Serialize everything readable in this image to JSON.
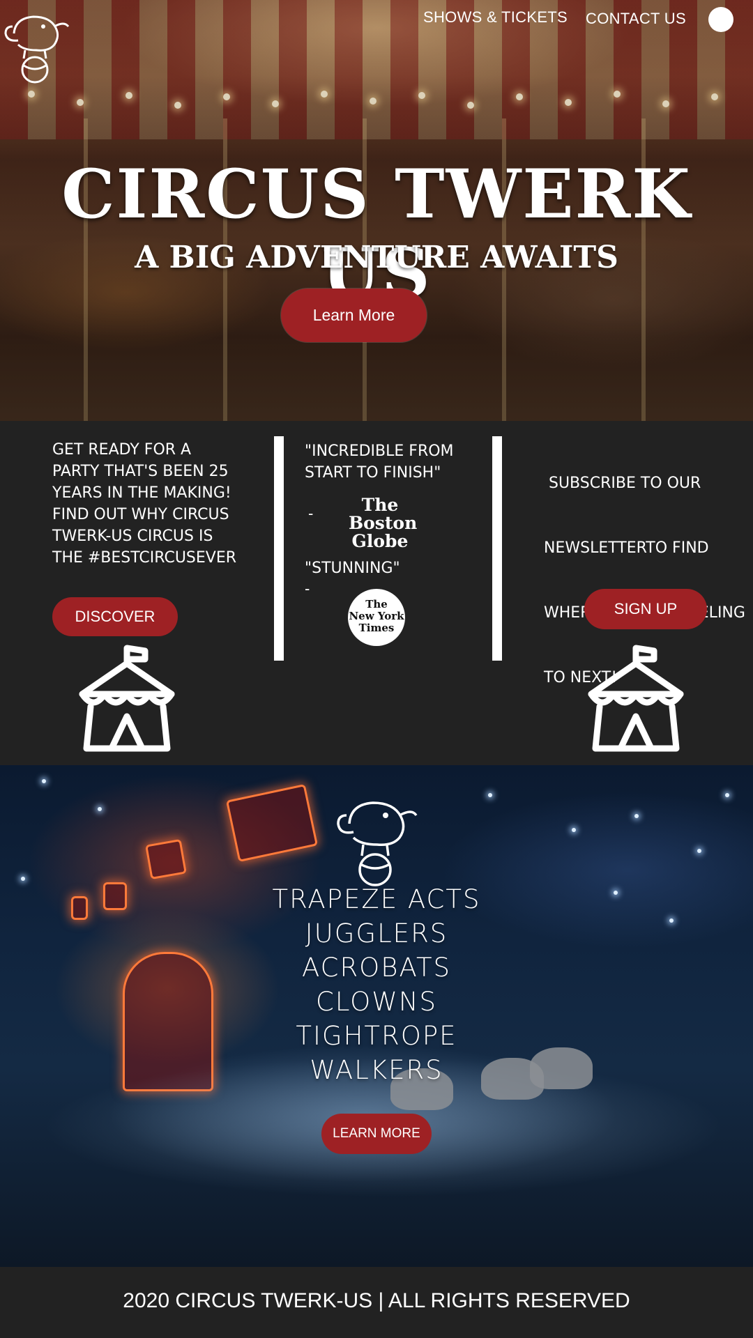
{
  "nav": {
    "shows_tickets": "SHOWS & TICKETS",
    "contact_us": "CONTACT US"
  },
  "hero": {
    "title": "CIRCUS TWERK US",
    "subtitle": "A BIG ADVENTURE AWAITS",
    "button": "Learn More"
  },
  "info": {
    "intro_lines": [
      "GET READY FOR A",
      "PARTY THAT'S BEEN 25",
      "YEARS IN THE MAKING!",
      "FIND OUT WHY CIRCUS",
      "TWERK-US CIRCUS IS",
      "THE #BESTCIRCUSEVER"
    ],
    "discover_button": "DISCOVER",
    "quote1_lines": [
      "\"INCREDIBLE FROM",
      "START TO FINISH\""
    ],
    "quote1_dash": "-",
    "globe_lines": [
      "The",
      "Boston",
      "Globe"
    ],
    "quote2": "\"STUNNING\"",
    "quote2_dash": "-",
    "nyt_lines": [
      "The",
      "New York",
      "Times"
    ],
    "newsletter_lines": [
      " SUBSCRIBE TO OUR",
      "NEWSLETTERTO FIND",
      "WHERE WE'RE TRAVELING",
      "TO NEXT!"
    ],
    "signup_button": "SIGN UP"
  },
  "arena": {
    "acts": [
      "TRAPEZE ACTS",
      "JUGGLERS",
      "ACROBATS",
      "CLOWNS",
      "TIGHTROPE",
      "WALKERS"
    ],
    "button": "LEARN MORE"
  },
  "footer": {
    "text": "2020 CIRCUS TWERK-US | ALL RIGHTS RESERVED"
  },
  "colors": {
    "accent_red": "#9e2124",
    "band_dark": "#222222",
    "text": "#ffffff"
  },
  "icons": [
    "elephant-on-ball-logo-icon",
    "circus-tent-icon"
  ]
}
